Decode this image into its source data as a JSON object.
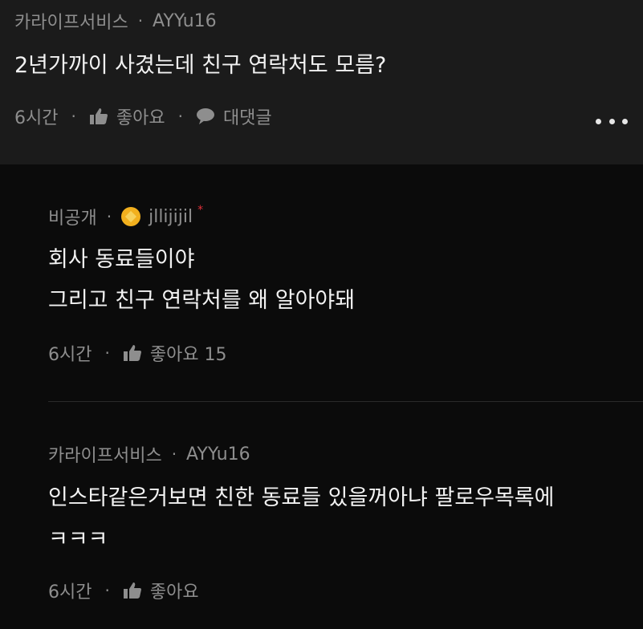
{
  "main_comment": {
    "company": "카라이프서비스",
    "separator": "·",
    "nickname": "AYYu16",
    "text": "2년가까이 사겼는데 친구 연락처도 모름?",
    "time": "6시간",
    "like_label": "좋아요",
    "reply_label": "대댓글"
  },
  "replies": [
    {
      "company": "비공개",
      "separator": "·",
      "nickname": "jllijijil",
      "author_mark": "*",
      "lines": [
        "회사 동료들이야",
        "그리고 친구 연락처를 왜 알아야돼"
      ],
      "time": "6시간",
      "like_label": "좋아요 15"
    },
    {
      "company": "카라이프서비스",
      "separator": "·",
      "nickname": "AYYu16",
      "lines": [
        "인스타같은거보면 친한 동료들 있을꺼아냐 팔로우목록에",
        "ㅋㅋㅋ"
      ],
      "time": "6시간",
      "like_label": "좋아요"
    }
  ],
  "colors": {
    "top_bg": "#1b1b1b",
    "page_bg": "#0b0b0b",
    "meta_text": "#8e8e8e",
    "body_text": "#f2f2f2",
    "badge": "#f2b01e",
    "author_mark": "#e0303a"
  },
  "icons": [
    "thumbs-up-icon",
    "speech-bubble-icon",
    "more-icon",
    "level-badge-icon"
  ]
}
